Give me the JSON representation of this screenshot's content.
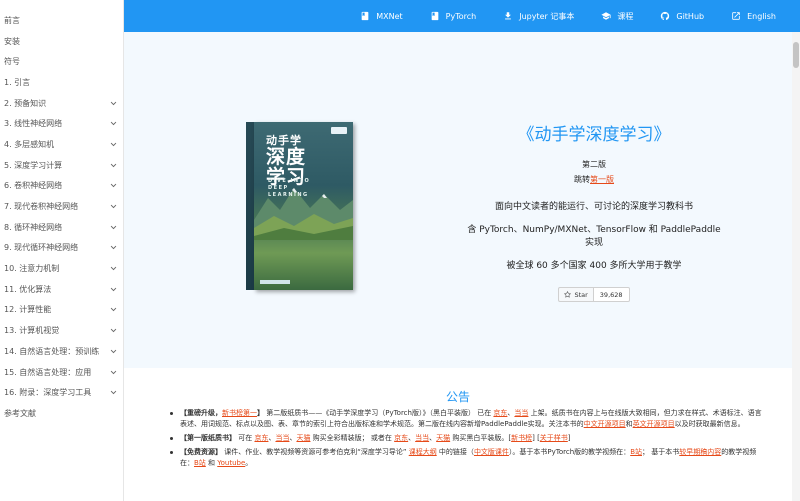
{
  "sidebar": {
    "items": [
      {
        "label": "前言",
        "chevron": false
      },
      {
        "label": "安装",
        "chevron": false
      },
      {
        "label": "符号",
        "chevron": false
      },
      {
        "label": "1. 引言",
        "chevron": false
      },
      {
        "label": "2. 预备知识",
        "chevron": true
      },
      {
        "label": "3. 线性神经网络",
        "chevron": true
      },
      {
        "label": "4. 多层感知机",
        "chevron": true
      },
      {
        "label": "5. 深度学习计算",
        "chevron": true
      },
      {
        "label": "6. 卷积神经网络",
        "chevron": true
      },
      {
        "label": "7. 现代卷积神经网络",
        "chevron": true
      },
      {
        "label": "8. 循环神经网络",
        "chevron": true
      },
      {
        "label": "9. 现代循环神经网络",
        "chevron": true
      },
      {
        "label": "10. 注意力机制",
        "chevron": true
      },
      {
        "label": "11. 优化算法",
        "chevron": true
      },
      {
        "label": "12. 计算性能",
        "chevron": true
      },
      {
        "label": "13. 计算机视觉",
        "chevron": true
      },
      {
        "label": "14. 自然语言处理：预训练",
        "chevron": true
      },
      {
        "label": "15. 自然语言处理：应用",
        "chevron": true
      },
      {
        "label": "16. 附录：深度学习工具",
        "chevron": true
      },
      {
        "label": "参考文献",
        "chevron": false
      }
    ]
  },
  "header": {
    "links": [
      {
        "name": "mxnet",
        "label": "MXNet",
        "icon": "book-icon"
      },
      {
        "name": "pytorch",
        "label": "PyTorch",
        "icon": "book-icon"
      },
      {
        "name": "jupyter",
        "label": "Jupyter 记事本",
        "icon": "download-icon"
      },
      {
        "name": "courses",
        "label": "课程",
        "icon": "school-icon"
      },
      {
        "name": "github",
        "label": "GitHub",
        "icon": "github-icon"
      },
      {
        "name": "english",
        "label": "English",
        "icon": "external-link-icon"
      }
    ]
  },
  "hero": {
    "book": {
      "title_line1": "动手学",
      "title_line2": "深度",
      "title_line3": "学习",
      "subtitle": "DIVE INTO DEEP LEARNING"
    },
    "title": "《动手学深度学习》",
    "edition": "第二版",
    "jump_prefix": "跳转",
    "jump_link": "第一版",
    "line1": "面向中文读者的能运行、可讨论的深度学习教科书",
    "line2": "含 PyTorch、NumPy/MXNet、TensorFlow 和 PaddlePaddle 实现",
    "line3": "被全球 60 多个国家 400 多所大学用于教学",
    "star_label": "Star",
    "star_count": "39,628"
  },
  "announcement": {
    "title": "公告",
    "item1": {
      "bold": "【重磅升级，",
      "link1": "新书榜第一",
      "bold_end": "】",
      "text1": " 第二版纸质书——《动手学深度学习（PyTorch版）》（黑白平装版） 已在 ",
      "link2": "京东",
      "sep1": "、",
      "link3": "当当",
      "text2": " 上架。纸质书在内容上与在线版大致相同，但力求在样式、术语标注、语言表述、用词规范、标点以及图、表、章节的索引上符合出版标准和学术规范。第二版在线内容新增PaddlePaddle实现。关注本书的",
      "link4": "中文开源项目",
      "text3": "和",
      "link5": "英文开源项目",
      "text4": "以及时获取最新信息。"
    },
    "item2": {
      "bold": "【第一版纸质书】",
      "text1": " 可在 ",
      "link1": "京东",
      "sep1": "、",
      "link2": "当当",
      "sep2": "、",
      "link3": "天猫",
      "text2": " 购买全彩精装版； 或者在 ",
      "link4": "京东",
      "sep3": "、",
      "link5": "当当",
      "sep4": "、",
      "link6": "天猫",
      "text3": " 购买黑白平装版。[",
      "link7": "新书榜",
      "text4": "] [",
      "link8": "关于样书",
      "text5": "]"
    },
    "item3": {
      "bold": "【免费资源】",
      "text1": " 课件、作业、教学视频等资源可参考伯克利“深度学习导论” ",
      "link1": "课程大纲",
      "text2": " 中的链接（",
      "link2": "中文版课件",
      "text3": "）。基于本书PyTorch版的教学视频在：",
      "link3": "B站",
      "text4": "； 基于本书",
      "link4": "较早期稿内容",
      "text5": "的教学视频在：",
      "link5": "B站",
      "text6": " 和 ",
      "link6": "Youtube",
      "text7": "。"
    }
  },
  "colors": {
    "header_bg": "#2196f3",
    "hero_bg": "#f3f9fe",
    "accent": "#2196f3",
    "link": "#e64a19"
  }
}
